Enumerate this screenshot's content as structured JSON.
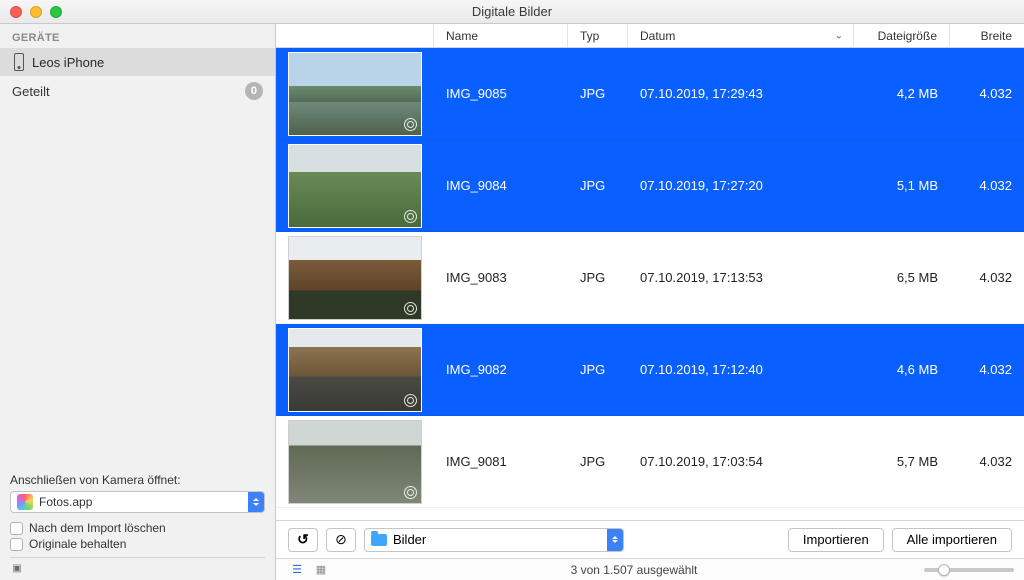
{
  "window": {
    "title": "Digitale Bilder"
  },
  "sidebar": {
    "devices_header": "GERÄTE",
    "device_name": "Leos iPhone",
    "shared_label": "Geteilt",
    "shared_count": "0",
    "open_with_label": "Anschließen von Kamera öffnet:",
    "open_with_app": "Fotos.app",
    "delete_after_label": "Nach dem Import löschen",
    "keep_originals_label": "Originale behalten"
  },
  "columns": {
    "name": "Name",
    "type": "Typ",
    "date": "Datum",
    "size": "Dateigröße",
    "width": "Breite"
  },
  "rows": [
    {
      "id": "9085",
      "name": "IMG_9085",
      "type": "JPG",
      "date": "07.10.2019, 17:29:43",
      "size": "4,2 MB",
      "width": "4.032",
      "selected": true
    },
    {
      "id": "9084",
      "name": "IMG_9084",
      "type": "JPG",
      "date": "07.10.2019, 17:27:20",
      "size": "5,1 MB",
      "width": "4.032",
      "selected": true
    },
    {
      "id": "9083",
      "name": "IMG_9083",
      "type": "JPG",
      "date": "07.10.2019, 17:13:53",
      "size": "6,5 MB",
      "width": "4.032",
      "selected": false
    },
    {
      "id": "9082",
      "name": "IMG_9082",
      "type": "JPG",
      "date": "07.10.2019, 17:12:40",
      "size": "4,6 MB",
      "width": "4.032",
      "selected": true
    },
    {
      "id": "9081",
      "name": "IMG_9081",
      "type": "JPG",
      "date": "07.10.2019, 17:03:54",
      "size": "5,7 MB",
      "width": "4.032",
      "selected": false
    }
  ],
  "actionbar": {
    "destination": "Bilder",
    "import": "Importieren",
    "import_all": "Alle importieren"
  },
  "status": {
    "text": "3 von 1.507 ausgewählt"
  }
}
